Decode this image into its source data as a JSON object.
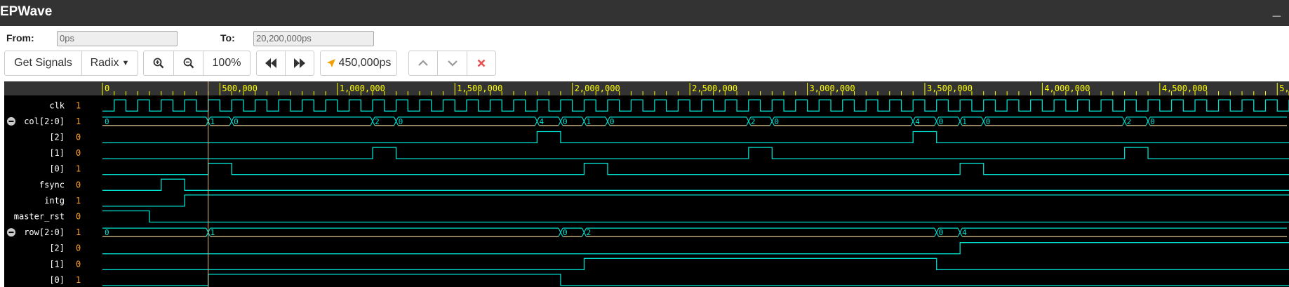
{
  "app": {
    "title": "EPWave",
    "minimize_label": "_"
  },
  "range": {
    "from_label": "From:",
    "from_value": "0ps",
    "to_label": "To:",
    "to_value": "20,200,000ps"
  },
  "toolbar": {
    "get_signals_label": "Get Signals",
    "radix_label": "Radix",
    "zoom_in_icon": "zoom-in-icon",
    "zoom_out_icon": "zoom-out-icon",
    "zoom_level": "100%",
    "prev_icon": "rewind-icon",
    "next_icon": "fast-forward-icon",
    "cursor_time": "450,000ps",
    "cursor_icon": "cursor-arrow-icon",
    "up_icon": "chevron-up-icon",
    "down_icon": "chevron-down-icon",
    "close_icon": "close-x-icon"
  },
  "colors": {
    "titlebar": "#333333",
    "wave": "#00e0d0",
    "bus_line": "#e0c890",
    "value": "#ffa020",
    "ruler_text": "#ffff00",
    "cursor": "#e0c090",
    "panel": "#000000"
  },
  "waveform": {
    "time_unit": "ps",
    "time_start": 0,
    "time_end": 5050000,
    "cursor_time": 450000,
    "ruler_labels": [
      {
        "t": 0,
        "label": "0"
      },
      {
        "t": 500000,
        "label": "500,000"
      },
      {
        "t": 1000000,
        "label": "1,000,000"
      },
      {
        "t": 1500000,
        "label": "1,500,000"
      },
      {
        "t": 2000000,
        "label": "2,000,000"
      },
      {
        "t": 2500000,
        "label": "2,500,000"
      },
      {
        "t": 3000000,
        "label": "3,000,000"
      },
      {
        "t": 3500000,
        "label": "3,500,000"
      },
      {
        "t": 4000000,
        "label": "4,000,000"
      },
      {
        "t": 4500000,
        "label": "4,500,000"
      },
      {
        "t": 5000000,
        "label": "5,"
      }
    ],
    "signals": [
      {
        "name": "clk",
        "value": "1",
        "type": "clock",
        "first_edge": 50000,
        "half_period": 50000
      },
      {
        "name": "col[2:0]",
        "value": "1",
        "type": "bus",
        "collapsible": true,
        "changes": [
          {
            "t": 0,
            "v": "0"
          },
          {
            "t": 450000,
            "v": "1"
          },
          {
            "t": 550000,
            "v": "0"
          },
          {
            "t": 1150000,
            "v": "2"
          },
          {
            "t": 1250000,
            "v": "0"
          },
          {
            "t": 1850000,
            "v": "4"
          },
          {
            "t": 1950000,
            "v": "0"
          },
          {
            "t": 2050000,
            "v": "1"
          },
          {
            "t": 2150000,
            "v": "0"
          },
          {
            "t": 2750000,
            "v": "2"
          },
          {
            "t": 2850000,
            "v": "0"
          },
          {
            "t": 3450000,
            "v": "4"
          },
          {
            "t": 3550000,
            "v": "0"
          },
          {
            "t": 3650000,
            "v": "1"
          },
          {
            "t": 3750000,
            "v": "0"
          },
          {
            "t": 4350000,
            "v": "2"
          },
          {
            "t": 4450000,
            "v": "0"
          }
        ]
      },
      {
        "name": "[2]",
        "value": "0",
        "type": "bit",
        "changes": [
          {
            "t": 0,
            "v": 0
          },
          {
            "t": 1850000,
            "v": 1
          },
          {
            "t": 1950000,
            "v": 0
          },
          {
            "t": 3450000,
            "v": 1
          },
          {
            "t": 3550000,
            "v": 0
          }
        ]
      },
      {
        "name": "[1]",
        "value": "0",
        "type": "bit",
        "changes": [
          {
            "t": 0,
            "v": 0
          },
          {
            "t": 1150000,
            "v": 1
          },
          {
            "t": 1250000,
            "v": 0
          },
          {
            "t": 2750000,
            "v": 1
          },
          {
            "t": 2850000,
            "v": 0
          },
          {
            "t": 4350000,
            "v": 1
          },
          {
            "t": 4450000,
            "v": 0
          }
        ]
      },
      {
        "name": "[0]",
        "value": "1",
        "type": "bit",
        "changes": [
          {
            "t": 0,
            "v": 0
          },
          {
            "t": 450000,
            "v": 1
          },
          {
            "t": 550000,
            "v": 0
          },
          {
            "t": 2050000,
            "v": 1
          },
          {
            "t": 2150000,
            "v": 0
          },
          {
            "t": 3650000,
            "v": 1
          },
          {
            "t": 3750000,
            "v": 0
          }
        ]
      },
      {
        "name": "fsync",
        "value": "0",
        "type": "bit",
        "changes": [
          {
            "t": 0,
            "v": 0
          },
          {
            "t": 250000,
            "v": 1
          },
          {
            "t": 350000,
            "v": 0
          }
        ]
      },
      {
        "name": "intg",
        "value": "1",
        "type": "bit",
        "changes": [
          {
            "t": 0,
            "v": 0
          },
          {
            "t": 350000,
            "v": 1
          }
        ]
      },
      {
        "name": "master_rst",
        "value": "0",
        "type": "bit",
        "changes": [
          {
            "t": 0,
            "v": 1
          },
          {
            "t": 200000,
            "v": 0
          }
        ]
      },
      {
        "name": "row[2:0]",
        "value": "1",
        "type": "bus",
        "collapsible": true,
        "changes": [
          {
            "t": 0,
            "v": "0"
          },
          {
            "t": 450000,
            "v": "1"
          },
          {
            "t": 1950000,
            "v": "0"
          },
          {
            "t": 2050000,
            "v": "2"
          },
          {
            "t": 3550000,
            "v": "0"
          },
          {
            "t": 3650000,
            "v": "4"
          }
        ]
      },
      {
        "name": "[2]",
        "value": "0",
        "type": "bit",
        "changes": [
          {
            "t": 0,
            "v": 0
          },
          {
            "t": 3650000,
            "v": 1
          }
        ]
      },
      {
        "name": "[1]",
        "value": "0",
        "type": "bit",
        "changes": [
          {
            "t": 0,
            "v": 0
          },
          {
            "t": 2050000,
            "v": 1
          },
          {
            "t": 3550000,
            "v": 0
          }
        ]
      },
      {
        "name": "[0]",
        "value": "1",
        "type": "bit",
        "changes": [
          {
            "t": 0,
            "v": 0
          },
          {
            "t": 450000,
            "v": 1
          },
          {
            "t": 1950000,
            "v": 0
          }
        ]
      }
    ]
  }
}
